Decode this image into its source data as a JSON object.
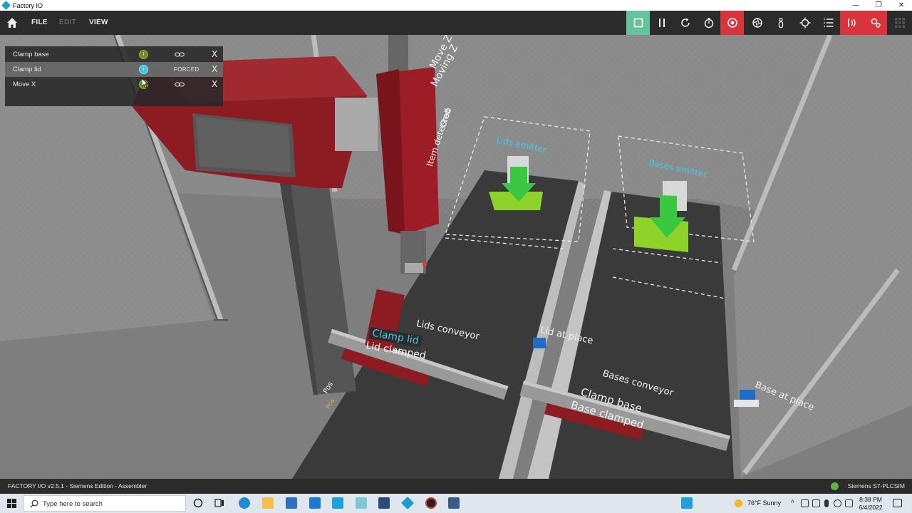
{
  "window": {
    "title": "Factory IO",
    "controls": [
      "—",
      "❐",
      "✕"
    ]
  },
  "menubar": {
    "items": [
      {
        "label": "FILE",
        "enabled": true
      },
      {
        "label": "EDIT",
        "enabled": false
      },
      {
        "label": "VIEW",
        "enabled": true
      }
    ],
    "tools": [
      "stop",
      "pause",
      "reset",
      "timer",
      "record",
      "camera-orbit",
      "person",
      "target",
      "list",
      "sensors",
      "drivers",
      "grid"
    ]
  },
  "tag_panel": {
    "rows": [
      {
        "name": "Clamp base",
        "state_icon": "io-dot-off",
        "status": "",
        "link_icon": "link-icon"
      },
      {
        "name": "Clamp lid",
        "state_icon": "io-dot-forced",
        "status": "FORCED",
        "link_icon": ""
      },
      {
        "name": "Move X",
        "state_icon": "io-dot-off",
        "status": "",
        "link_icon": "link-icon"
      }
    ],
    "dot_letter": "I",
    "close_glyph": "X"
  },
  "scene_labels": {
    "move_z": "Move Z",
    "moving_z": "Moving Z",
    "grab": "Grab",
    "item_detected": "Item detected",
    "lids_emitter": "Lids emitter",
    "bases_emitter": "Bases emitter",
    "lids_conveyor": "Lids conveyor",
    "clamp_lid": "Clamp lid",
    "lid_clamped": "Lid clamped",
    "lid_at_place": "Lid at place",
    "bases_conveyor": "Bases conveyor",
    "clamp_base": "Clamp base",
    "base_clamped": "Base clamped",
    "base_at_place": "Base at place",
    "pos_left_1": "Pos",
    "pos_left_2": "Pos"
  },
  "statusbar": {
    "left": "FACTORY I/O v2.5.1 - Siemens Edition - Assembler",
    "right": "Siemens S7-PLCSIM"
  },
  "taskbar": {
    "search_placeholder": "Type here to search",
    "weather": "76°F  Sunny",
    "time": "8:38 PM",
    "date": "6/4/2022"
  },
  "colors": {
    "accent_green": "#64c39a",
    "record_red": "#d9343c",
    "forced_blue": "#3bc6e8",
    "label_blue": "#46c6e6"
  }
}
